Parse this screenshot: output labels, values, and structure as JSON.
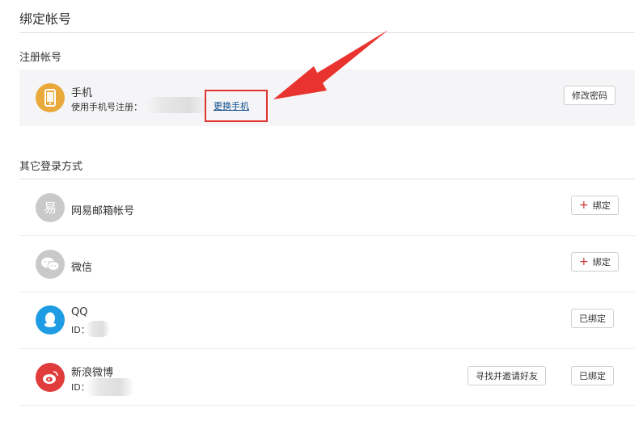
{
  "page": {
    "title": "绑定帐号"
  },
  "registered": {
    "section_title": "注册帐号",
    "title": "手机",
    "subtitle": "使用手机号注册：",
    "change_link": "更换手机",
    "button": "修改密码"
  },
  "other": {
    "section_title": "其它登录方式",
    "items": [
      {
        "title": "网易邮箱帐号",
        "button": "绑定"
      },
      {
        "title": "微信",
        "button": "绑定"
      },
      {
        "title": "QQ",
        "sub": "ID：",
        "button": "已绑定"
      },
      {
        "title": "新浪微博",
        "sub": "ID：",
        "secondary_button": "寻找并邀请好友",
        "button": "已绑定"
      }
    ]
  },
  "colors": {
    "phone_icon": "#e9a93b",
    "netease_icon": "#c9c9c9",
    "wechat_icon": "#c9c9c9",
    "qq_icon": "#1f9ce3",
    "weibo_icon": "#e03c3c",
    "annotation_red": "#e0332f"
  },
  "icons": [
    "phone-icon",
    "netease-mail-icon",
    "wechat-icon",
    "qq-icon",
    "weibo-icon",
    "plus-icon",
    "arrow-annotation"
  ]
}
